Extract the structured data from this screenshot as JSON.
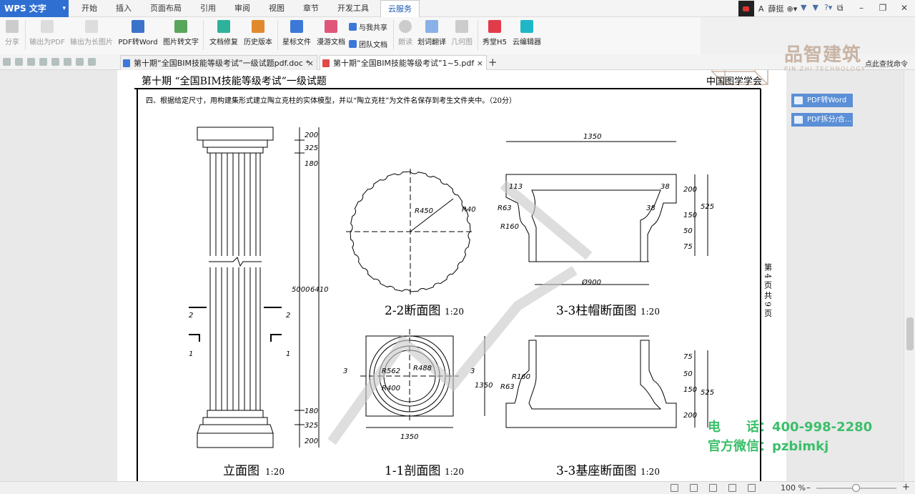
{
  "app": {
    "logo": "WPS 文字"
  },
  "menu": [
    "开始",
    "插入",
    "页面布局",
    "引用",
    "审阅",
    "视图",
    "章节",
    "开发工具",
    "云服务"
  ],
  "user": {
    "prefix": "A",
    "name": "薛挺"
  },
  "ribbon": {
    "share": "分享",
    "export_pdf": "输出为PDF",
    "export_long_image": "输出为长图片",
    "pdf_to_word": "PDF转Word",
    "image_to_text": "图片转文字",
    "doc_repair": "文档修复",
    "history": "历史版本",
    "starred": "星标文件",
    "roaming": "漫游文档",
    "shared_with_me": "与我共享",
    "team_docs": "团队文档",
    "read_aloud": "朗读",
    "translate": "划词翻译",
    "qa": "几何图",
    "xiutang": "秀堂H5",
    "cloud_editor": "云编辑器"
  },
  "tabs": [
    {
      "label": "第十期“全国BIM技能等级考试”一级试题pdf.doc *",
      "close": "×"
    },
    {
      "label": "第十期“全国BIM技能等级考试”1~5.pdf",
      "close": "×"
    }
  ],
  "side": {
    "pdf_to_word": "PDF转Word",
    "pdf_split": "PDF拆分/合..."
  },
  "brand": {
    "name": "品智建筑",
    "sub": "PIN ZHI TECHNOLOGY",
    "help": "点此查找命令"
  },
  "contact": {
    "phone_label": "电　　话：",
    "phone": "400-998-2280",
    "wechat_label": "官方微信：",
    "wechat": "pzbimkj"
  },
  "doc": {
    "header_left": "第十期 “全国BIM技能等级考试”一级试题",
    "header_right": "中国图学学会",
    "question": "四、根据给定尺寸，用构建集形式建立陶立克柱的实体模型，并以“陶立克柱”为文件名保存到考生文件夹中。（20分）",
    "page_info": "第 4 页 共 9 页",
    "titles": {
      "elevation": "立面图",
      "sec22": "2-2断面图",
      "sec33cap": "3-3柱帽断面图",
      "sec11": "1-1剖面图",
      "sec33base": "3-3基座断面图",
      "scale": "1:20"
    },
    "dims": {
      "d200": "200",
      "d325": "325",
      "d180": "180",
      "d5000": "5000",
      "d6410": "6410",
      "d1350": "1350",
      "r450": "R450",
      "r40": "R40",
      "r63": "R63",
      "r160": "R160",
      "d900": "Ø900",
      "d113": "113",
      "d38": "38",
      "d75": "75",
      "d150": "150",
      "d50": "50",
      "d525": "525",
      "r562": "R562",
      "r488": "R488",
      "r400": "R400",
      "sec2": "2",
      "sec1": "1",
      "sec3": "3"
    }
  },
  "status": {
    "zoom": "100 %"
  }
}
